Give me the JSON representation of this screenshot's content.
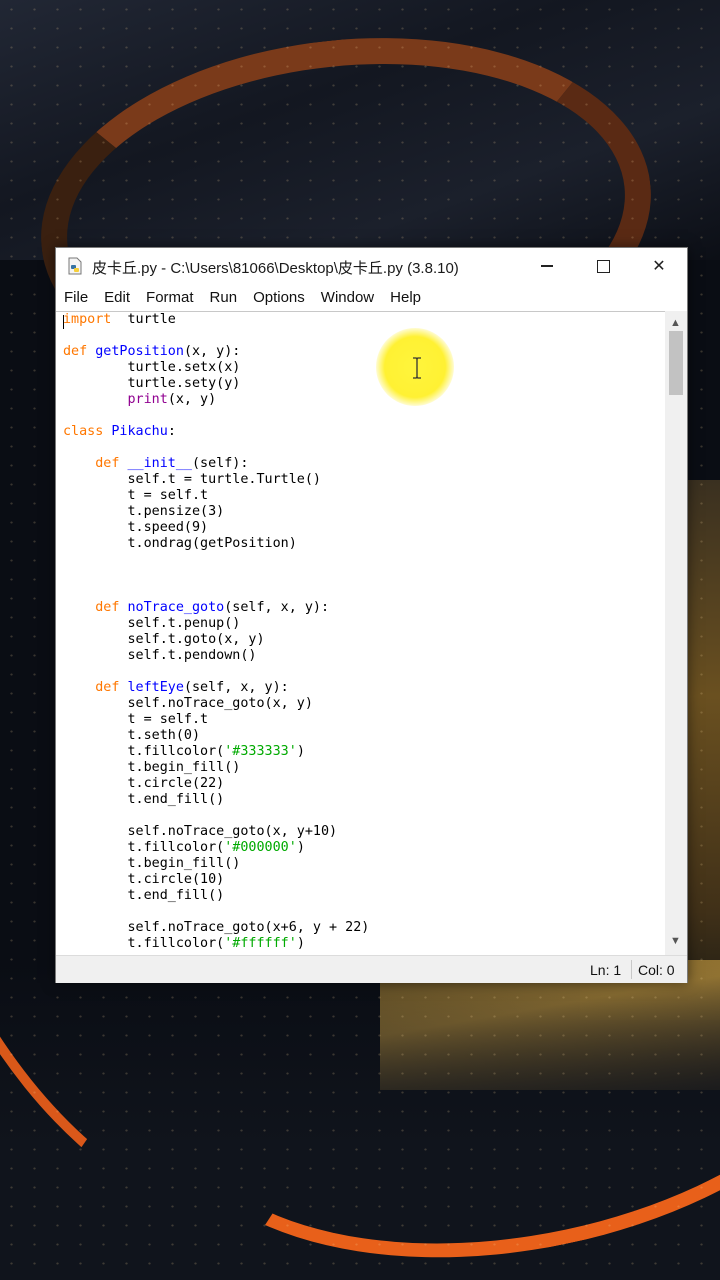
{
  "window": {
    "title": "皮卡丘.py - C:\\Users\\81066\\Desktop\\皮卡丘.py (3.8.10)",
    "minimize_glyph": "",
    "close_glyph": "✕"
  },
  "menu": [
    "File",
    "Edit",
    "Format",
    "Run",
    "Options",
    "Window",
    "Help"
  ],
  "code_lines": [
    [
      [
        "kw",
        "import"
      ],
      [
        "",
        "  turtle"
      ]
    ],
    [],
    [
      [
        "kw",
        "def"
      ],
      [
        "",
        " "
      ],
      [
        "fn",
        "getPosition"
      ],
      [
        "",
        "(x, y):"
      ]
    ],
    [
      [
        "",
        "        turtle.setx(x)"
      ]
    ],
    [
      [
        "",
        "        turtle.sety(y)"
      ]
    ],
    [
      [
        "",
        "        "
      ],
      [
        "bi",
        "print"
      ],
      [
        "",
        "(x, y)"
      ]
    ],
    [],
    [
      [
        "kw",
        "class"
      ],
      [
        "",
        " "
      ],
      [
        "fn",
        "Pikachu"
      ],
      [
        "",
        ":"
      ]
    ],
    [],
    [
      [
        "",
        "    "
      ],
      [
        "kw",
        "def"
      ],
      [
        "",
        " "
      ],
      [
        "fn",
        "__init__"
      ],
      [
        "",
        "(self):"
      ]
    ],
    [
      [
        "",
        "        self.t = turtle.Turtle()"
      ]
    ],
    [
      [
        "",
        "        t = self.t"
      ]
    ],
    [
      [
        "",
        "        t.pensize(3)"
      ]
    ],
    [
      [
        "",
        "        t.speed(9)"
      ]
    ],
    [
      [
        "",
        "        t.ondrag(getPosition)"
      ]
    ],
    [],
    [],
    [],
    [
      [
        "",
        "    "
      ],
      [
        "kw",
        "def"
      ],
      [
        "",
        " "
      ],
      [
        "fn",
        "noTrace_goto"
      ],
      [
        "",
        "(self, x, y):"
      ]
    ],
    [
      [
        "",
        "        self.t.penup()"
      ]
    ],
    [
      [
        "",
        "        self.t.goto(x, y)"
      ]
    ],
    [
      [
        "",
        "        self.t.pendown()"
      ]
    ],
    [],
    [
      [
        "",
        "    "
      ],
      [
        "kw",
        "def"
      ],
      [
        "",
        " "
      ],
      [
        "fn",
        "leftEye"
      ],
      [
        "",
        "(self, x, y):"
      ]
    ],
    [
      [
        "",
        "        self.noTrace_goto(x, y)"
      ]
    ],
    [
      [
        "",
        "        t = self.t"
      ]
    ],
    [
      [
        "",
        "        t.seth(0)"
      ]
    ],
    [
      [
        "",
        "        t.fillcolor("
      ],
      [
        "str",
        "'#333333'"
      ],
      [
        "",
        ")"
      ]
    ],
    [
      [
        "",
        "        t.begin_fill()"
      ]
    ],
    [
      [
        "",
        "        t.circle(22)"
      ]
    ],
    [
      [
        "",
        "        t.end_fill()"
      ]
    ],
    [],
    [
      [
        "",
        "        self.noTrace_goto(x, y+10)"
      ]
    ],
    [
      [
        "",
        "        t.fillcolor("
      ],
      [
        "str",
        "'#000000'"
      ],
      [
        "",
        ")"
      ]
    ],
    [
      [
        "",
        "        t.begin_fill()"
      ]
    ],
    [
      [
        "",
        "        t.circle(10)"
      ]
    ],
    [
      [
        "",
        "        t.end_fill()"
      ]
    ],
    [],
    [
      [
        "",
        "        self.noTrace_goto(x+6, y + 22)"
      ]
    ],
    [
      [
        "",
        "        t.fillcolor("
      ],
      [
        "str",
        "'#ffffff'"
      ],
      [
        "",
        ")"
      ]
    ]
  ],
  "status": {
    "line": "Ln: 1",
    "col": "Col: 0"
  },
  "colors": {
    "keyword": "#ff7700",
    "definition": "#0000ff",
    "builtin": "#900090",
    "string": "#00aa00",
    "cursor_highlight": "#fff23c"
  }
}
